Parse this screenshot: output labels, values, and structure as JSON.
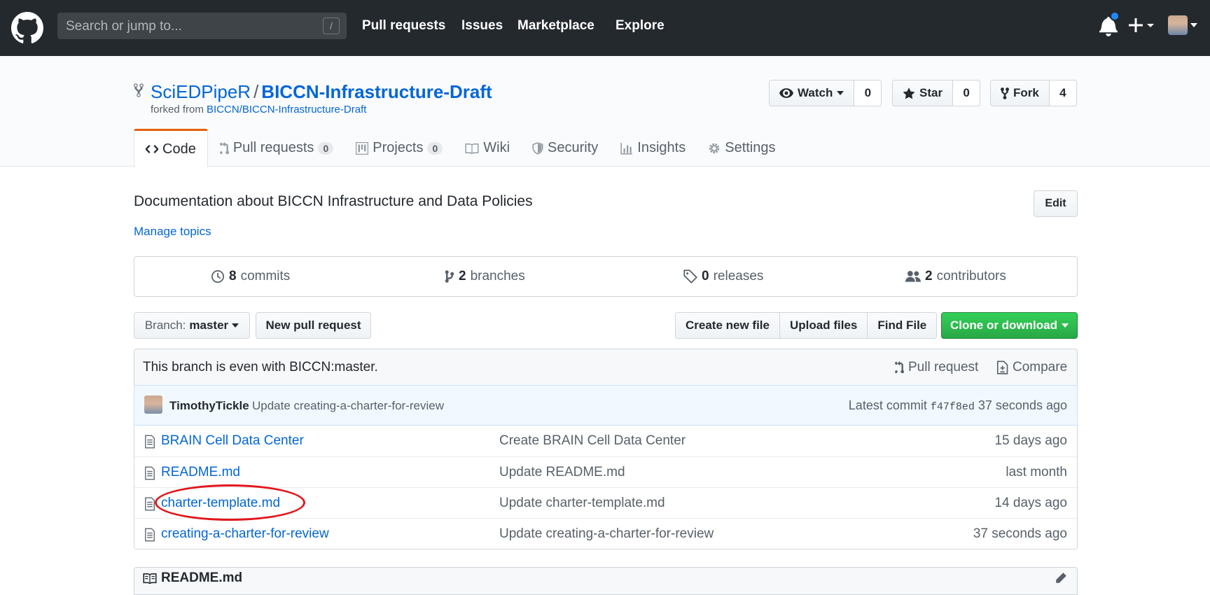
{
  "header": {
    "search_placeholder": "Search or jump to...",
    "search_shortcut": "/",
    "nav": [
      "Pull requests",
      "Issues",
      "Marketplace",
      "Explore"
    ]
  },
  "repo": {
    "owner": "SciEDPipeR",
    "separator": "/",
    "name": "BICCN-Infrastructure-Draft",
    "forked_label": "forked from",
    "forked_from": "BICCN/BICCN-Infrastructure-Draft",
    "actions": {
      "watch": {
        "label": "Watch",
        "count": "0"
      },
      "star": {
        "label": "Star",
        "count": "0"
      },
      "fork": {
        "label": "Fork",
        "count": "4"
      }
    }
  },
  "tabs": [
    {
      "label": "Code",
      "selected": true
    },
    {
      "label": "Pull requests",
      "count": "0"
    },
    {
      "label": "Projects",
      "count": "0"
    },
    {
      "label": "Wiki"
    },
    {
      "label": "Security"
    },
    {
      "label": "Insights"
    },
    {
      "label": "Settings"
    }
  ],
  "description": "Documentation about BICCN Infrastructure and Data Policies",
  "manage_topics": "Manage topics",
  "edit_label": "Edit",
  "summary": {
    "commits": {
      "num": "8",
      "label": "commits"
    },
    "branches": {
      "num": "2",
      "label": "branches"
    },
    "releases": {
      "num": "0",
      "label": "releases"
    },
    "contributors": {
      "num": "2",
      "label": "contributors"
    }
  },
  "filenav": {
    "branch_label": "Branch:",
    "branch_name": "master",
    "new_pr": "New pull request",
    "create_file": "Create new file",
    "upload_files": "Upload files",
    "find_file": "Find File",
    "clone": "Clone or download"
  },
  "branch_info": {
    "text": "This branch is even with BICCN:master.",
    "pull_request": "Pull request",
    "compare": "Compare"
  },
  "commit": {
    "author": "TimothyTickle",
    "message": "Update creating-a-charter-for-review",
    "latest_label": "Latest commit",
    "sha": "f47f8ed",
    "age": "37 seconds ago"
  },
  "files": [
    {
      "name": "BRAIN Cell Data Center",
      "message": "Create BRAIN Cell Data Center",
      "age": "15 days ago"
    },
    {
      "name": "README.md",
      "message": "Update README.md",
      "age": "last month"
    },
    {
      "name": "charter-template.md",
      "message": "Update charter-template.md",
      "age": "14 days ago"
    },
    {
      "name": "creating-a-charter-for-review",
      "message": "Update creating-a-charter-for-review",
      "age": "37 seconds ago"
    }
  ],
  "readme_title": "README.md",
  "colors": {
    "header_bg": "#24292e",
    "link": "#0366d6",
    "clone_green": "#28a745",
    "tab_accent": "#e36209",
    "annotation_red": "#e3161b"
  }
}
